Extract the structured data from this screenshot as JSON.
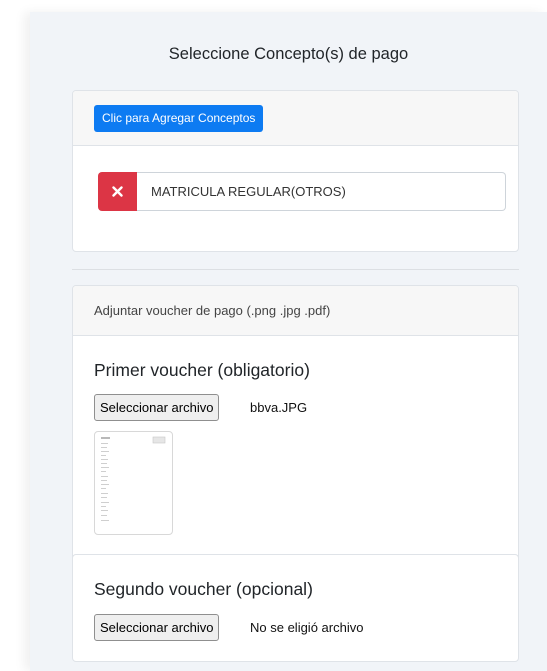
{
  "panel": {
    "title": "Seleccione Concepto(s) de pago"
  },
  "concepts": {
    "add_button_label": "Clic para Agregar Conceptos",
    "items": [
      {
        "value": "MATRICULA REGULAR(OTROS)",
        "remove_icon": "x-icon"
      }
    ]
  },
  "voucher": {
    "header": "Adjuntar voucher de pago (.png .jpg .pdf)",
    "first": {
      "title": "Primer voucher (obligatorio)",
      "button_label": "Seleccionar archivo",
      "file_name": "bbva.JPG"
    },
    "second": {
      "title": "Segundo voucher (opcional)",
      "button_label": "Seleccionar archivo",
      "file_name": "No se eligió archivo"
    }
  },
  "colors": {
    "primary": "#0d7bf2",
    "danger": "#dc3545",
    "panel_bg": "#f1f4f8"
  }
}
